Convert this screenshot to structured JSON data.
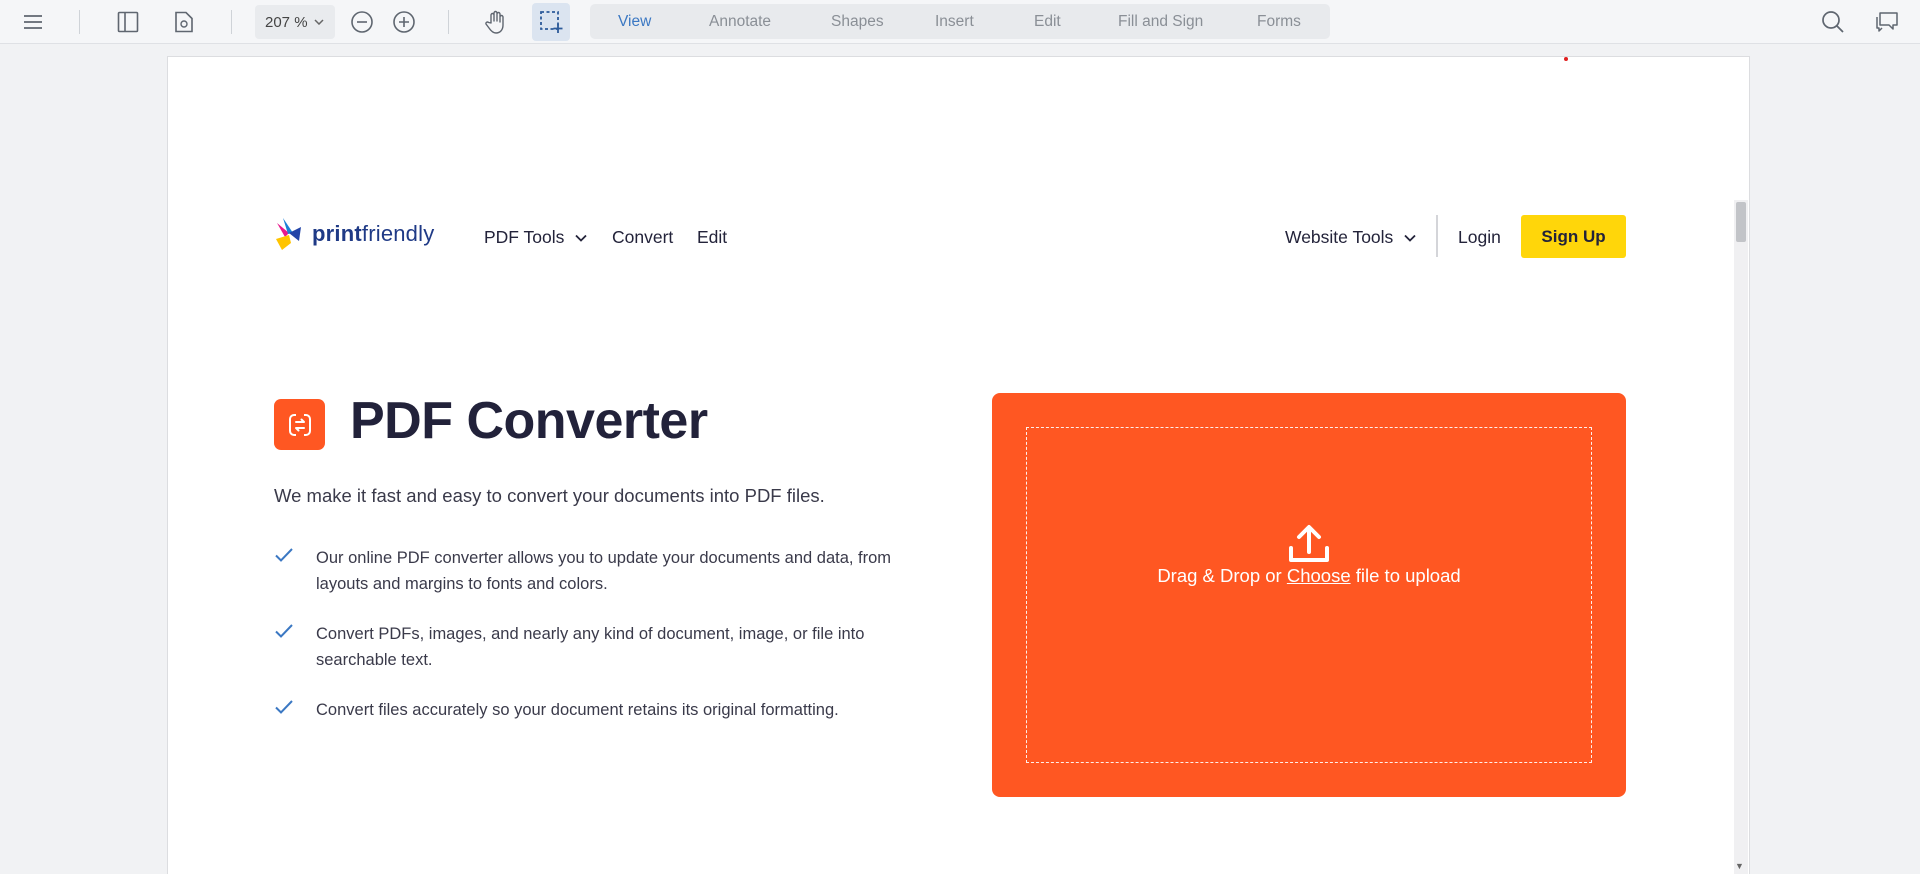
{
  "toolbar": {
    "zoom_value": "207 %",
    "tabs": [
      {
        "label": "View",
        "active": true
      },
      {
        "label": "Annotate"
      },
      {
        "label": "Shapes"
      },
      {
        "label": "Insert"
      },
      {
        "label": "Edit"
      },
      {
        "label": "Fill and Sign"
      },
      {
        "label": "Forms"
      }
    ],
    "icons": [
      "menu-icon",
      "sidebar-icon",
      "page-settings-icon",
      "zoom-out-icon",
      "zoom-in-icon",
      "hand-icon",
      "select-icon",
      "search-icon",
      "comments-icon"
    ]
  },
  "site": {
    "logo": {
      "bold": "print",
      "light": "friendly"
    },
    "nav": {
      "pdf_tools": "PDF Tools",
      "convert": "Convert",
      "edit": "Edit",
      "website_tools": "Website Tools",
      "login": "Login",
      "signup": "Sign Up"
    },
    "hero": {
      "title": "PDF Converter",
      "subtitle": "We make it fast and easy to convert your documents into PDF files.",
      "features": [
        "Our online PDF converter allows you to update your documents and data, from layouts and margins to fonts and colors.",
        "Convert PDFs, images, and nearly any kind of document, image, or file into searchable text.",
        "Convert files accurately so your document retains its original formatting."
      ]
    },
    "upload": {
      "text_before": "Drag & Drop or ",
      "link": "Choose",
      "text_after": " file to upload"
    }
  },
  "colors": {
    "accent": "#ff5722",
    "signup": "#ffd60a",
    "check": "#3b78c3",
    "tab_active": "#3b78c3"
  }
}
